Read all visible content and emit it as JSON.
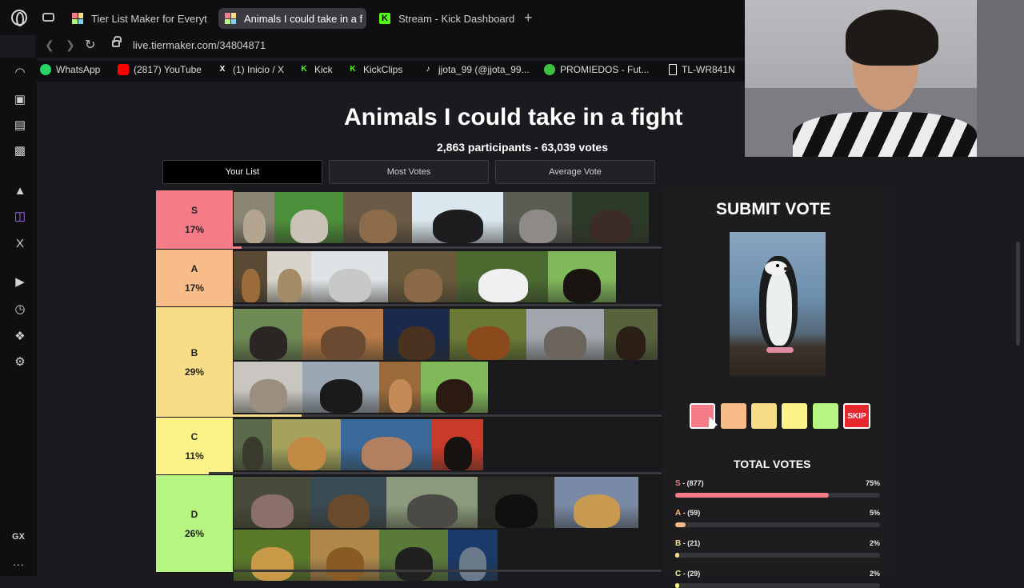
{
  "browser": {
    "tabs": [
      {
        "label": "Tier List Maker for Everyt",
        "active": false,
        "favicon": "tiermaker"
      },
      {
        "label": "Animals I could take in a f",
        "active": true,
        "favicon": "tiermaker"
      },
      {
        "label": "Stream - Kick Dashboard",
        "active": false,
        "favicon": "kick"
      }
    ],
    "new_tab": "+",
    "url": "live.tiermaker.com/34804871",
    "bookmarks": [
      {
        "label": "WhatsApp",
        "icon": "whatsapp-icon",
        "color": "#25d366"
      },
      {
        "label": "(2817) YouTube",
        "icon": "youtube-icon",
        "color": "#ff0000"
      },
      {
        "label": "(1) Inicio / X",
        "icon": "x-icon",
        "color": "#ffffff"
      },
      {
        "label": "Kick",
        "icon": "kick-icon",
        "color": "#53fc18"
      },
      {
        "label": "KickClips",
        "icon": "kick-icon",
        "color": "#53fc18"
      },
      {
        "label": "jjota_99 (@jjota_99...",
        "icon": "tiktok-icon",
        "color": "#ffffff"
      },
      {
        "label": "PROMIEDOS - Fut...",
        "icon": "soccer-ball-icon",
        "color": "#3fbf3f"
      },
      {
        "label": "TL-WR841N",
        "icon": "page-icon",
        "color": "#ffffff"
      }
    ],
    "sidebar_icons": [
      "speed-dial-icon",
      "shopping-bag-icon",
      "news-icon",
      "messenger-icon",
      "aria-icon",
      "twitch-icon",
      "x-icon",
      "player-icon",
      "history-icon",
      "extensions-icon",
      "settings-icon"
    ],
    "sidebar_gx": "GX",
    "sidebar_more": "..."
  },
  "page": {
    "title": "Animals I could take in a fight",
    "stats": "2,863 participants - 63,039 votes",
    "view_tabs": [
      {
        "label": "Your List",
        "active": true
      },
      {
        "label": "Most Votes",
        "active": false
      },
      {
        "label": "Average Vote",
        "active": false
      }
    ]
  },
  "tiers": [
    {
      "name": "S",
      "percent": "17%",
      "color": "#f47c86",
      "bar_fill": 0.02,
      "animals": [
        {
          "name": "rabbit",
          "w": 51,
          "bg": "#8a8573",
          "fg": "#b3a590"
        },
        {
          "name": "goose",
          "w": 86,
          "bg": "#4c8f3a",
          "fg": "#c9c2b6"
        },
        {
          "name": "capybara",
          "w": 86,
          "bg": "#6b5a45",
          "fg": "#8c6b4b"
        },
        {
          "name": "penguin",
          "w": 114,
          "bg": "#dbe7ef",
          "fg": "#1d1d1f"
        },
        {
          "name": "raccoon",
          "w": 86,
          "bg": "#5b5d55",
          "fg": "#8e8a85"
        },
        {
          "name": "turkey",
          "w": 96,
          "bg": "#2d3a28",
          "fg": "#3b2c27"
        }
      ]
    },
    {
      "name": "A",
      "percent": "17%",
      "color": "#f7bc87",
      "bar_fill": 0.0,
      "animals": [
        {
          "name": "cobra",
          "w": 42,
          "bg": "#5a4a35",
          "fg": "#9a6c3a"
        },
        {
          "name": "coyote",
          "w": 55,
          "bg": "#d8d4cc",
          "fg": "#a58a66"
        },
        {
          "name": "seal pup",
          "w": 96,
          "bg": "#dfe3e6",
          "fg": "#c7c9c6"
        },
        {
          "name": "deer",
          "w": 87,
          "bg": "#6a5a3c",
          "fg": "#8a6a46"
        },
        {
          "name": "panda",
          "w": 113,
          "bg": "#4a6a30",
          "fg": "#f0f0f0"
        },
        {
          "name": "rottweiler",
          "w": 85,
          "bg": "#7fb95a",
          "fg": "#1a1410"
        }
      ]
    },
    {
      "name": "B",
      "percent": "29%",
      "color": "#f9dc87",
      "bar_fill": 0.16,
      "animals": [
        {
          "name": "ostrich",
          "w": 86,
          "bg": "#6e8a54",
          "fg": "#2a2624"
        },
        {
          "name": "hyena",
          "w": 101,
          "bg": "#b87a48",
          "fg": "#6a4a30"
        },
        {
          "name": "eagle",
          "w": 83,
          "bg": "#1a2a4a",
          "fg": "#4a3220"
        },
        {
          "name": "orangutan",
          "w": 96,
          "bg": "#6a7a34",
          "fg": "#8a4a1c"
        },
        {
          "name": "wolf",
          "w": 97,
          "bg": "#a0a6ac",
          "fg": "#6a645c"
        },
        {
          "name": "moose",
          "w": 67,
          "bg": "#56633d",
          "fg": "#2c2016"
        },
        {
          "name": "lynx",
          "w": 86,
          "bg": "#c9c6c2",
          "fg": "#9a8e80"
        },
        {
          "name": "condor",
          "w": 96,
          "bg": "#9aa6b2",
          "fg": "#1a1a1a"
        },
        {
          "name": "kangaroo",
          "w": 52,
          "bg": "#9a6a3a",
          "fg": "#c48a58"
        },
        {
          "name": "horse",
          "w": 84,
          "bg": "#7fb95a",
          "fg": "#2a1a12"
        }
      ]
    },
    {
      "name": "C",
      "percent": "11%",
      "color": "#fbf38a",
      "bar_fill": -0.05,
      "animals": [
        {
          "name": "crocodile",
          "w": 48,
          "bg": "#5a6a4a",
          "fg": "#3a3a2c"
        },
        {
          "name": "giraffe",
          "w": 86,
          "bg": "#a4a25c",
          "fg": "#c08a44"
        },
        {
          "name": "cougar",
          "w": 114,
          "bg": "#3a6a9a",
          "fg": "#b08060"
        },
        {
          "name": "bull",
          "w": 64,
          "bg": "#c83a2a",
          "fg": "#151210"
        }
      ]
    },
    {
      "name": "D",
      "percent": "26%",
      "color": "#b6f582",
      "bar_fill": 0.0,
      "animals": [
        {
          "name": "hippo",
          "w": 96,
          "bg": "#4a4a3a",
          "fg": "#8a7068"
        },
        {
          "name": "grizzly bear",
          "w": 95,
          "bg": "#3a4a52",
          "fg": "#6a4a2c"
        },
        {
          "name": "rhino",
          "w": 114,
          "bg": "#8a9a7a",
          "fg": "#4c4a46"
        },
        {
          "name": "black panther",
          "w": 96,
          "bg": "#2a2a26",
          "fg": "#101010"
        },
        {
          "name": "cheetah",
          "w": 105,
          "bg": "#7a8aa6",
          "fg": "#c89a50"
        },
        {
          "name": "jaguar",
          "w": 96,
          "bg": "#5a7a2a",
          "fg": "#c89a48"
        },
        {
          "name": "lion",
          "w": 86,
          "bg": "#b0884a",
          "fg": "#8a5a24"
        },
        {
          "name": "gorilla",
          "w": 86,
          "bg": "#5a7a3a",
          "fg": "#202020"
        },
        {
          "name": "shark",
          "w": 62,
          "bg": "#1a3a6a",
          "fg": "#6a7a8a"
        }
      ]
    }
  ],
  "submit": {
    "title": "SUBMIT VOTE",
    "current_animal": "chinstrap penguin",
    "buttons": [
      {
        "tier": "S",
        "color": "#f47c86"
      },
      {
        "tier": "A",
        "color": "#f7bc87"
      },
      {
        "tier": "B",
        "color": "#f9dc87"
      },
      {
        "tier": "C",
        "color": "#fbf38a"
      },
      {
        "tier": "D",
        "color": "#b6f582"
      }
    ],
    "skip": "SKIP"
  },
  "total_votes": {
    "title": "TOTAL VOTES",
    "rows": [
      {
        "tier": "S",
        "count": " - (877)",
        "percent": "75%",
        "value": 0.75,
        "color": "#f47c86"
      },
      {
        "tier": "A",
        "count": " - (59)",
        "percent": "5%",
        "value": 0.05,
        "color": "#f7bc87"
      },
      {
        "tier": "B",
        "count": " - (21)",
        "percent": "2%",
        "value": 0.02,
        "color": "#f9dc87"
      },
      {
        "tier": "C",
        "count": " - (29)",
        "percent": "2%",
        "value": 0.02,
        "color": "#fbf38a"
      }
    ]
  }
}
